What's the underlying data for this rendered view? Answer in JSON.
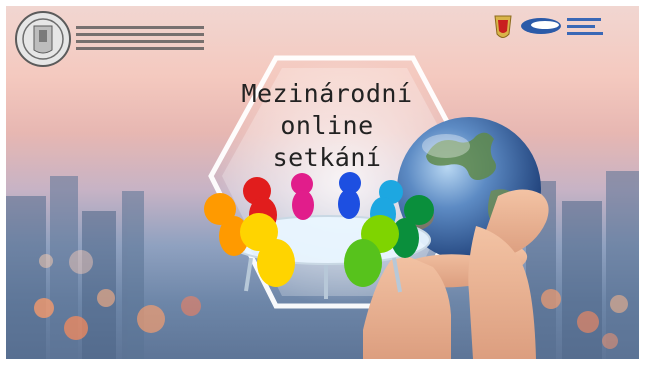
{
  "headline": {
    "line1": "Mezinárodní",
    "line2": "online",
    "line3": "setkání"
  },
  "logos": {
    "school_seal": "school-seal-logo",
    "coat_of_arms": "bulgarian-coat-of-arms",
    "partner_logo": "partner-logo"
  },
  "illustration": {
    "people": "colorful-people-around-table",
    "globe": "earth-globe-in-hands"
  },
  "colors": {
    "sky_top": "#f1d6d1",
    "sky_bottom": "#5e7597",
    "people": [
      "#ff9a00",
      "#e11d1d",
      "#e11d8b",
      "#1d4fe1",
      "#1da7e1",
      "#0a8f3c",
      "#7fd400",
      "#ffd400"
    ]
  }
}
